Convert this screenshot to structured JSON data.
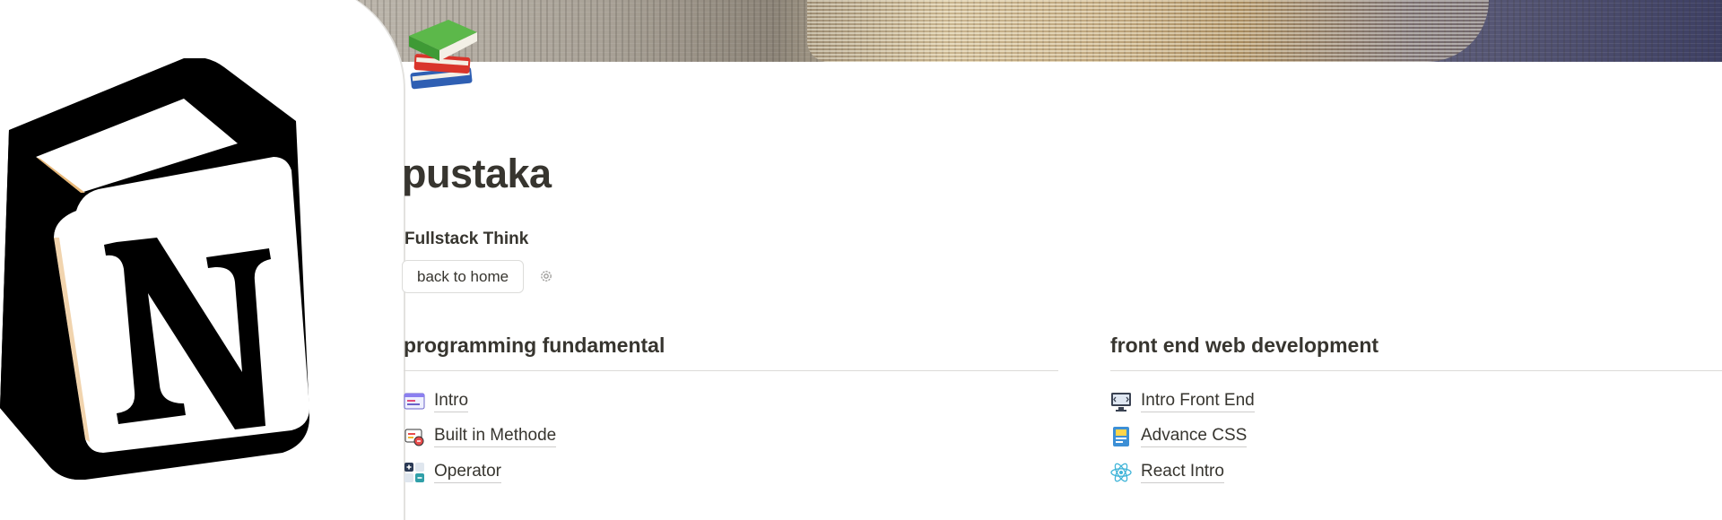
{
  "page": {
    "title": "pustaka",
    "subtitle": "Fullstack Think",
    "button_label": "back to home",
    "page_icon": "books-icon"
  },
  "sections": [
    {
      "heading": "programming fundamental",
      "items": [
        {
          "label": "Intro",
          "icon": "browser-window-icon"
        },
        {
          "label": "Built in Methode",
          "icon": "toolbox-icon"
        },
        {
          "label": "Operator",
          "icon": "calculator-symbols-icon"
        }
      ]
    },
    {
      "heading": "front end web development",
      "items": [
        {
          "label": "Intro Front End",
          "icon": "monitor-code-icon"
        },
        {
          "label": "Advance CSS",
          "icon": "css-file-icon"
        },
        {
          "label": "React Intro",
          "icon": "react-atom-icon"
        }
      ]
    }
  ],
  "colors": {
    "text": "#37352f",
    "divider": "#dcdbd8",
    "background": "#ffffff"
  }
}
